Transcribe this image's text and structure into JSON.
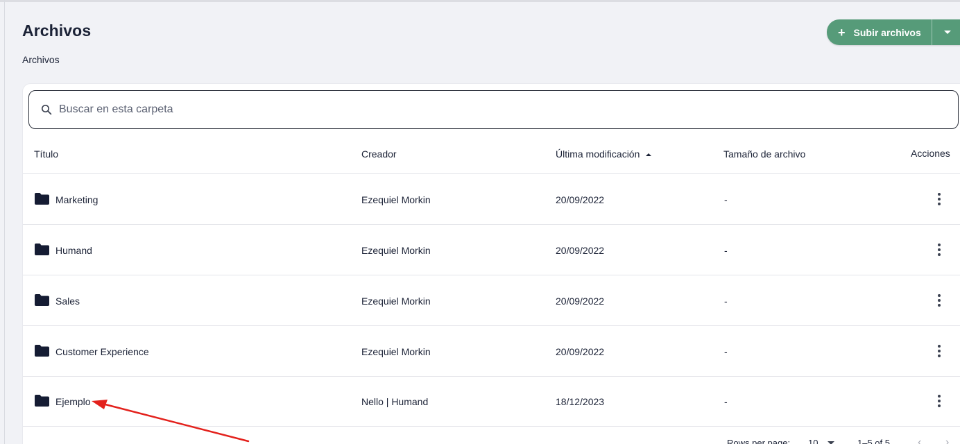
{
  "header": {
    "title": "Archivos",
    "breadcrumb": "Archivos",
    "upload_plus": "+",
    "upload_label": "Subir archivos"
  },
  "search": {
    "placeholder": "Buscar en esta carpeta",
    "value": ""
  },
  "table": {
    "columns": {
      "title": "Título",
      "creator": "Creador",
      "modified": "Última modificación",
      "size": "Tamaño de archivo",
      "actions": "Acciones"
    },
    "rows": [
      {
        "title": "Marketing",
        "creator": "Ezequiel Morkin",
        "modified": "20/09/2022",
        "size": "-"
      },
      {
        "title": "Humand",
        "creator": "Ezequiel Morkin",
        "modified": "20/09/2022",
        "size": "-"
      },
      {
        "title": "Sales",
        "creator": "Ezequiel Morkin",
        "modified": "20/09/2022",
        "size": "-"
      },
      {
        "title": "Customer Experience",
        "creator": "Ezequiel Morkin",
        "modified": "20/09/2022",
        "size": "-"
      },
      {
        "title": "Ejemplo",
        "creator": "Nello | Humand",
        "modified": "18/12/2023",
        "size": "-"
      }
    ]
  },
  "pagination": {
    "rows_per_page_label": "Rows per page:",
    "rows_per_page_value": "10",
    "range": "1–5 of 5"
  },
  "colors": {
    "primary_button": "#569b79",
    "annotation_arrow": "#e3211c",
    "folder_icon": "#151c33"
  }
}
